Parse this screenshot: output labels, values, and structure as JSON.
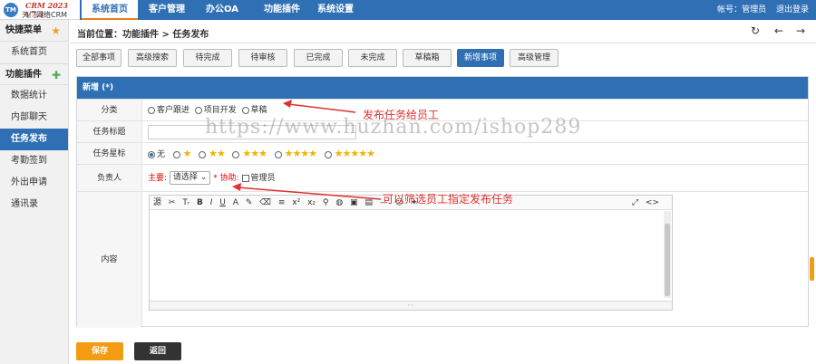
{
  "logo": {
    "version": "CRM 2023 V7.3",
    "name": "天门网络CRM",
    "mark": "TM"
  },
  "nav": {
    "tabs": [
      "系统首页",
      "客户管理",
      "办公OA",
      "功能插件",
      "系统设置"
    ],
    "active": "系统首页"
  },
  "account": {
    "label": "帐号：管理员",
    "logout": "退出登录"
  },
  "sidebar": {
    "quick_title": "快捷菜单",
    "quick_items": [
      "系统首页"
    ],
    "plugin_title": "功能插件",
    "plugin_items": [
      "数据统计",
      "内部聊天",
      "任务发布",
      "考勤签到",
      "外出申请",
      "通讯录"
    ],
    "active": "任务发布"
  },
  "breadcrumb": "当前位置：功能插件 > 任务发布",
  "toolbar": {
    "buttons": [
      "全部事项",
      "高级搜索",
      "待完成",
      "待审核",
      "已完成",
      "未完成",
      "草稿箱",
      "新增事项",
      "高级管理"
    ],
    "active": "新增事项"
  },
  "form": {
    "header": "新增 (*)",
    "category": {
      "label": "分类",
      "options": [
        "客户跟进",
        "项目开发",
        "草稿"
      ]
    },
    "title": {
      "label": "任务标题",
      "value": ""
    },
    "stars": {
      "label": "任务星标",
      "none_label": "无",
      "levels": [
        1,
        2,
        3,
        4,
        5
      ],
      "selected": 0
    },
    "owner": {
      "label": "负责人",
      "main_label": "主要:",
      "select_value": "请选择",
      "required": "*",
      "assist_label": "协助:",
      "admin_label": "管理员"
    },
    "content": {
      "label": "内容"
    }
  },
  "editor": {
    "tools": [
      "源",
      "✂",
      "Tᵣ",
      "B",
      "I",
      "U",
      "A",
      "✎",
      "⌫",
      "≡",
      "x²",
      "x₂",
      "⚲",
      "◍",
      "▣",
      "▤",
      "—",
      "☺",
      "✦"
    ],
    "right_tools": [
      "⤢",
      "<>"
    ],
    "resize": "⋯"
  },
  "buttons": {
    "save": "保存",
    "back": "返回"
  },
  "annotations": {
    "a1": "发布任务给员工",
    "a2": "可以筛选员工指定发布任务"
  },
  "watermark": "https://www.huzhan.com/ishop289",
  "colors": {
    "primary": "#2f6fb4",
    "accent": "#f39c12",
    "annotation": "#e03030"
  }
}
